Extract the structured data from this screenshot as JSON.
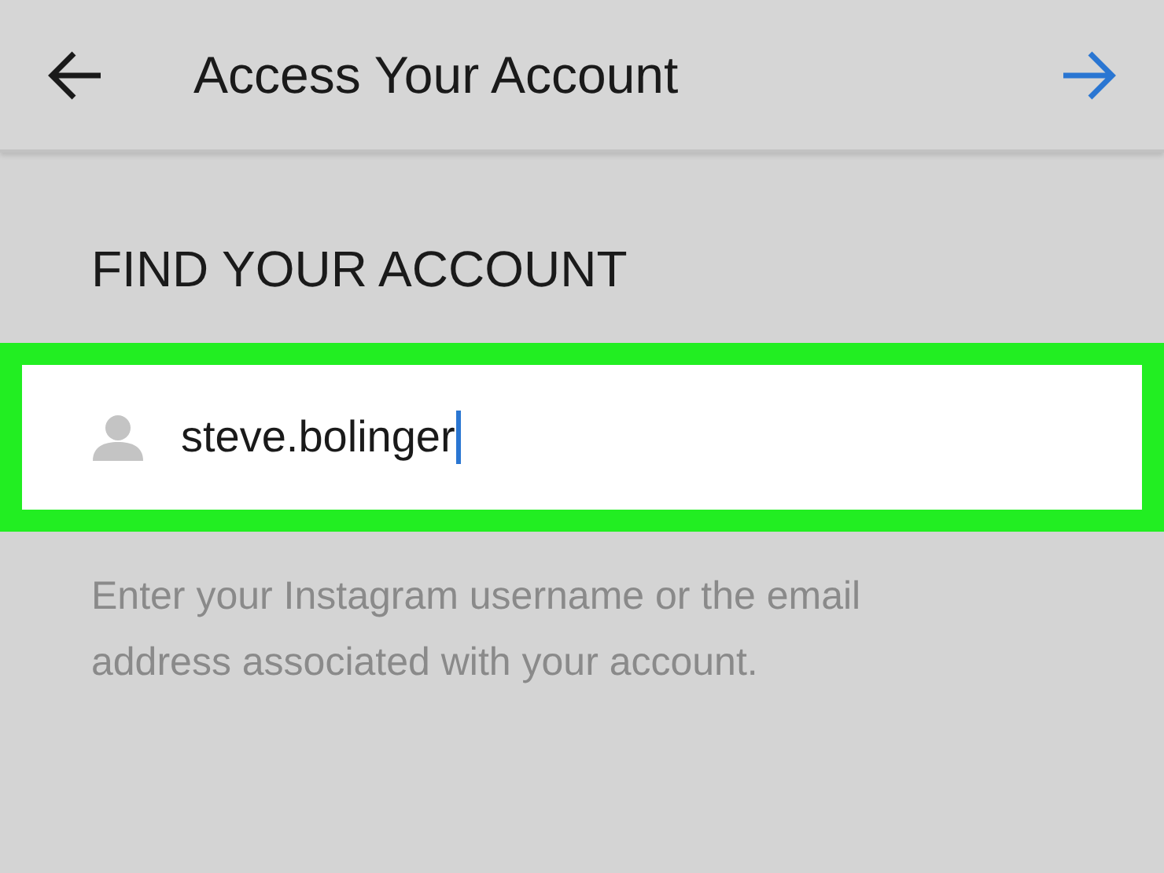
{
  "header": {
    "title": "Access Your Account"
  },
  "section": {
    "heading": "FIND YOUR ACCOUNT"
  },
  "username_field": {
    "value": "steve.bolinger",
    "focused": true,
    "highlighted": true
  },
  "hint": "Enter your Instagram username or the email address associated with your account."
}
